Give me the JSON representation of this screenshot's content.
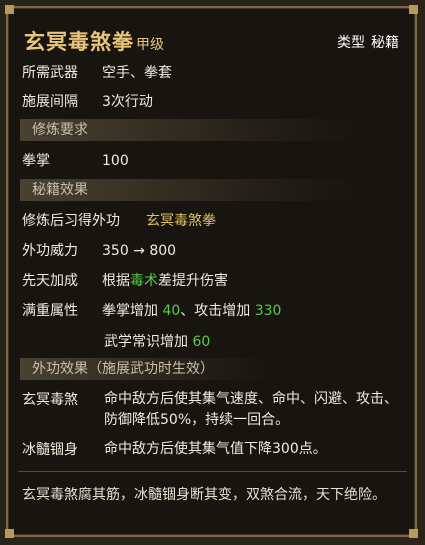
{
  "skill": {
    "name": "玄冥毒煞拳",
    "grade": "甲级",
    "type_label": "类型",
    "type_value": "秘籍"
  },
  "rows": {
    "weapon": {
      "label": "所需武器",
      "value": "空手、拳套"
    },
    "interval": {
      "label": "施展间隔",
      "value": "3次行动"
    }
  },
  "sections": {
    "training": "修炼要求",
    "book_effect": "秘籍效果",
    "external_effect": "外功效果（施展武功时生效）"
  },
  "training": {
    "label": "拳掌",
    "value": "100"
  },
  "effect": {
    "learn_label": "修炼后习得外功",
    "learn_value": "玄冥毒煞拳",
    "power_label": "外功威力",
    "power_value": "350 → 800",
    "innate_label": "先天加成",
    "innate_pre": "根据",
    "innate_attr": "毒术",
    "innate_post": "差提升伤害",
    "full_label": "满重属性",
    "full_line1_a": "拳掌增加 ",
    "full_line1_b": "40",
    "full_line1_c": "、攻击增加 ",
    "full_line1_d": "330",
    "full_line2_a": "武学常识增加 ",
    "full_line2_b": "60"
  },
  "external": {
    "poison_label": "玄冥毒煞",
    "poison_desc": "命中敌方后使其集气速度、命中、闪避、攻击、防御降低50%，持续一回合。",
    "ice_label": "冰髓锢身",
    "ice_desc": "命中敌方后使其集气值下降300点。"
  },
  "flavor": "玄冥毒煞腐其筋，冰髓锢身断其变，双煞合流，天下绝险。",
  "colors": {
    "gold": "#e3c063",
    "green": "#5cc94a",
    "title": "#e9c57a"
  }
}
